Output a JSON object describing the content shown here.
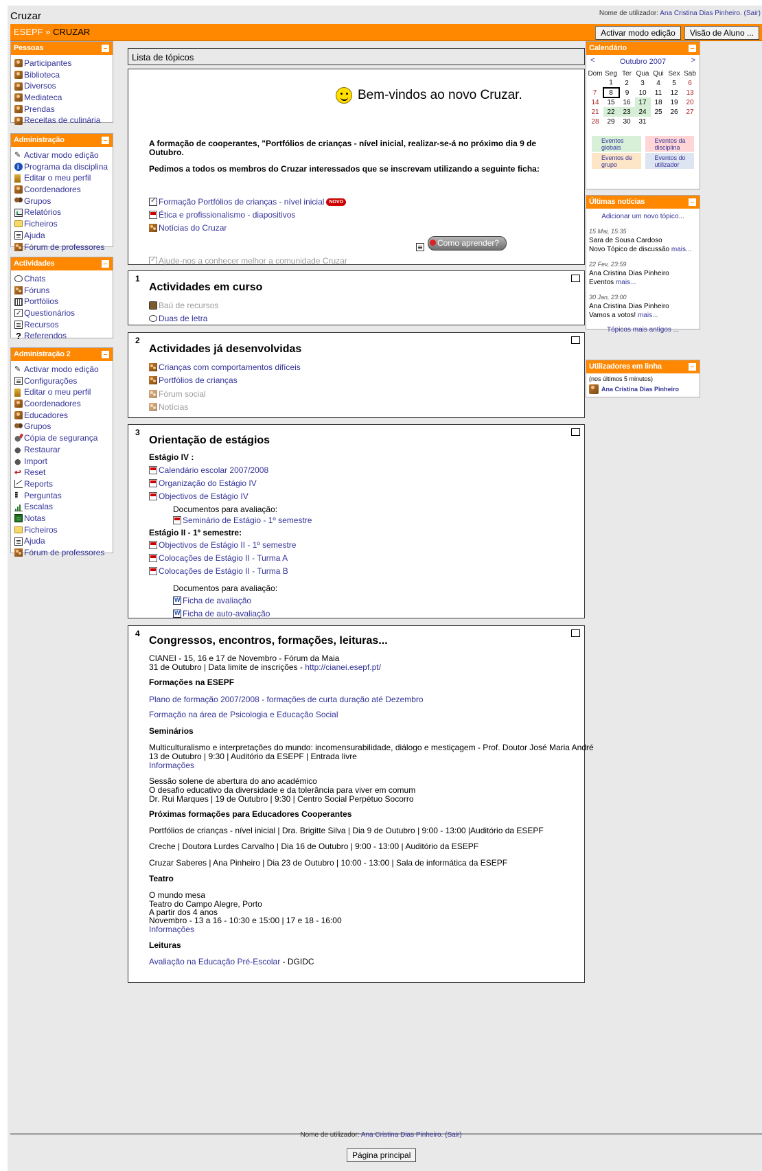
{
  "header": {
    "site_title": "Cruzar",
    "login_prefix": "Nome de utilizador:",
    "user_name": "Ana Cristina Dias Pinheiro.",
    "logout": "(Sair)"
  },
  "navbar": {
    "crumb_home": "ESEPF",
    "separator": "»",
    "crumb_current": "CRUZAR",
    "edit_button": "Activar modo edição",
    "student_view_button": "Visão de Aluno ..."
  },
  "blocks": {
    "pessoas": {
      "title": "Pessoas",
      "items": [
        {
          "label": "Participantes",
          "icon": "people-icon"
        },
        {
          "label": "Biblioteca",
          "icon": "people-icon"
        },
        {
          "label": "Diversos",
          "icon": "people-icon"
        },
        {
          "label": "Mediateca",
          "icon": "people-icon"
        },
        {
          "label": "Prendas",
          "icon": "people-icon"
        },
        {
          "label": "Receitas de culinária",
          "icon": "people-icon"
        }
      ]
    },
    "administracao": {
      "title": "Administração",
      "items": [
        {
          "label": "Activar modo edição",
          "icon": "pencil-icon"
        },
        {
          "label": "Programa da disciplina",
          "icon": "info-icon"
        },
        {
          "label": "Editar o meu perfil",
          "icon": "edit-icon"
        },
        {
          "label": "Coordenadores",
          "icon": "people-icon"
        },
        {
          "label": "Grupos",
          "icon": "group-icon"
        },
        {
          "label": "Relatórios",
          "icon": "report-icon"
        },
        {
          "label": "Ficheiros",
          "icon": "folder-icon"
        },
        {
          "label": "Ajuda",
          "icon": "doc-icon"
        },
        {
          "label": "Fórum de professores",
          "icon": "forum-icon"
        }
      ]
    },
    "actividades": {
      "title": "Actividades",
      "items": [
        {
          "label": "Chats",
          "icon": "chat-icon"
        },
        {
          "label": "Fóruns",
          "icon": "forum-icon"
        },
        {
          "label": "Portfólios",
          "icon": "portfolio-icon"
        },
        {
          "label": "Questionários",
          "icon": "quest-icon"
        },
        {
          "label": "Recursos",
          "icon": "doc-icon"
        },
        {
          "label": "Referendos",
          "icon": "question-icon"
        }
      ]
    },
    "administracao2": {
      "title": "Administração 2",
      "items": [
        {
          "label": "Activar modo edição",
          "icon": "pencil-icon"
        },
        {
          "label": "Configurações",
          "icon": "doc-icon"
        },
        {
          "label": "Editar o meu perfil",
          "icon": "edit-icon"
        },
        {
          "label": "Coordenadores",
          "icon": "people-icon"
        },
        {
          "label": "Educadores",
          "icon": "people-icon"
        },
        {
          "label": "Grupos",
          "icon": "group-icon"
        },
        {
          "label": "Cópia de segurança",
          "icon": "backup-icon"
        },
        {
          "label": "Restaurar",
          "icon": "restore-icon"
        },
        {
          "label": "Import",
          "icon": "restore-icon"
        },
        {
          "label": "Reset",
          "icon": "reset-icon"
        },
        {
          "label": "Reports",
          "icon": "chart-icon"
        },
        {
          "label": "Perguntas",
          "icon": "question-bank-icon"
        },
        {
          "label": "Escalas",
          "icon": "scale-icon"
        },
        {
          "label": "Notas",
          "icon": "grades-icon"
        },
        {
          "label": "Ficheiros",
          "icon": "folder-icon"
        },
        {
          "label": "Ajuda",
          "icon": "doc-icon"
        },
        {
          "label": "Fórum de professores",
          "icon": "forum-icon"
        }
      ]
    }
  },
  "main": {
    "topics_title": "Lista de tópicos",
    "section0": {
      "welcome": "Bem-vindos ao novo Cruzar.",
      "announce_line1": "A formação de cooperantes, \"Portfólios de crianças - nível inicial, realizar-se-á no próximo dia 9 de",
      "announce_line2": "Outubro.",
      "request": "Pedimos a todos os membros do Cruzar interessados que se inscrevam utilizando a seguinte ficha:",
      "links": [
        {
          "label": "Formação Portfólios de crianças - nível inicial",
          "badge": "NOVO"
        },
        {
          "label": "Ética e profissionalismo - diapositivos"
        },
        {
          "label": "Notícias do Cruzar"
        }
      ],
      "como_button": "Como aprender?",
      "hidden_link": "Ajude-nos a conhecer melhor a comunidade Cruzar"
    },
    "section1": {
      "num": "1",
      "title": "Actividades em curso",
      "links": [
        "Baú de recursos",
        "Duas de letra"
      ]
    },
    "section2": {
      "num": "2",
      "title": "Actividades já desenvolvidas",
      "links": [
        "Crianças com comportamentos difíceis",
        "Portfólios de crianças",
        "Fórum social",
        "Notícias"
      ]
    },
    "section3": {
      "num": "3",
      "title": "Orientação de estágios",
      "sub1": "Estágio IV :",
      "links1": [
        "Calendário escolar 2007/2008",
        "Organização do Estágio IV",
        "Objectivos de Estágio IV"
      ],
      "docs_label": "Documentos para avaliação:",
      "doc1": "Seminário de Estágio - 1º semestre",
      "sub2": "Estágio II - 1º semestre:",
      "links2": [
        "Objectivos de Estágio II - 1º semestre",
        "Colocações de Estágio II - Turma A",
        "Colocações de Estágio II - Turma B"
      ],
      "docs_label2": "Documentos para avaliação:",
      "docs2": [
        "Ficha de avaliação",
        "Ficha de auto-avaliação"
      ]
    },
    "section4": {
      "num": "4",
      "title": "Congressos, encontros, formações, leituras...",
      "cianei1": "CIANEI - 15, 16 e 17 de Novembro - Fórum da Maia",
      "cianei2": "31 de Outubro | Data limite de inscrições - ",
      "cianei_link": "http://cianei.esepf.pt/",
      "h_formacoes": "Formações na ESEPF",
      "form_link1": "Plano de formação 2007/2008 - formações de curta duração até Dezembro",
      "form_link2": "Formação na área de Psicologia e Educação Social",
      "h_seminarios": "Seminários",
      "sem1_line1": "Multiculturalismo e interpretações do mundo: incomensurabilidade, diálogo e mestiçagem - Prof. Doutor José Maria André",
      "sem1_line2": "13 de Outubro | 9:30 | Auditório da ESEPF | Entrada livre",
      "sem1_link": "Informações",
      "sem2_line1": "Sessão solene de abertura do ano académico",
      "sem2_line2": "O desafio educativo da diversidade e da tolerância para viver em comum",
      "sem2_line3": "Dr. Rui Marques | 19 de Outubro | 9:30 | Centro Social Perpétuo Socorro",
      "h_proximas": "Próximas formações para Educadores Cooperantes",
      "prox1": "Portfólios de crianças - nível inicial | Dra. Brigitte Silva | Dia 9 de Outubro | 9:00 - 13:00 |Auditório da ESEPF",
      "prox2": "Creche | Doutora Lurdes Carvalho | Dia 16 de Outubro | 9:00 - 13:00 | Auditório da ESEPF",
      "prox3": "Cruzar Saberes | Ana Pinheiro | Dia 23 de Outubro | 10:00 - 13:00 | Sala de informática da ESEPF",
      "h_teatro": "Teatro",
      "teatro1": "O mundo mesa",
      "teatro2": "Teatro do Campo Alegre, Porto",
      "teatro3": "A partir dos 4 anos",
      "teatro4": "Novembro - 13 a 16 - 10:30 e 15:00 | 17 e 18 - 16:00",
      "teatro_link": "Informações",
      "h_leituras": "Leituras",
      "leit_link": "Avaliação na Educação Pré-Escolar",
      "leit_suffix": " - DGIDC"
    }
  },
  "calendar": {
    "title": "Calendário",
    "prev": "<",
    "next": ">",
    "month": "Outubro 2007",
    "weekdays": [
      "Dom",
      "Seg",
      "Ter",
      "Qua",
      "Qui",
      "Sex",
      "Sab"
    ],
    "weeks": [
      [
        "",
        "1",
        "2",
        "3",
        "4",
        "5",
        "6"
      ],
      [
        "7",
        "8",
        "9",
        "10",
        "11",
        "12",
        "13"
      ],
      [
        "14",
        "15",
        "16",
        "17",
        "18",
        "19",
        "20"
      ],
      [
        "21",
        "22",
        "23",
        "24",
        "25",
        "26",
        "27"
      ],
      [
        "28",
        "29",
        "30",
        "31",
        "",
        "",
        ""
      ]
    ],
    "today": "8",
    "event_days": [
      "17",
      "22",
      "23",
      "24"
    ],
    "legend": [
      {
        "label": "Eventos globais",
        "color": "#d8efd8"
      },
      {
        "label": "Eventos da disciplina",
        "color": "#ffd5d5"
      },
      {
        "label": "Eventos de grupo",
        "color": "#fde5c8"
      },
      {
        "label": "Eventos do utilizador",
        "color": "#dde4f2"
      }
    ]
  },
  "news": {
    "title": "Últimas notícias",
    "add_link": "Adicionar um novo tópico...",
    "items": [
      {
        "date": "15 Mai, 15:35",
        "author": "Sara de Sousa Cardoso",
        "text": "Novo Tópico de discussão",
        "more": "mais..."
      },
      {
        "date": "22 Fev, 23:59",
        "author": "Ana Cristina Dias Pinheiro",
        "text": "Eventos",
        "more": "mais..."
      },
      {
        "date": "30 Jan, 23:00",
        "author": "Ana Cristina Dias Pinheiro",
        "text": "Vamos a votos!",
        "more": "mais..."
      }
    ],
    "older": "Tópicos mais antigos ..."
  },
  "online": {
    "title": "Utilizadores em linha",
    "subtitle": "(nos últimos 5 minutos)",
    "user": "Ana Cristina Dias Pinheiro"
  },
  "footer": {
    "login_prefix": "Nome de utilizador:",
    "user_name": "Ana Cristina Dias Pinheiro.",
    "logout": "(Sair)",
    "home_button": "Página principal"
  }
}
